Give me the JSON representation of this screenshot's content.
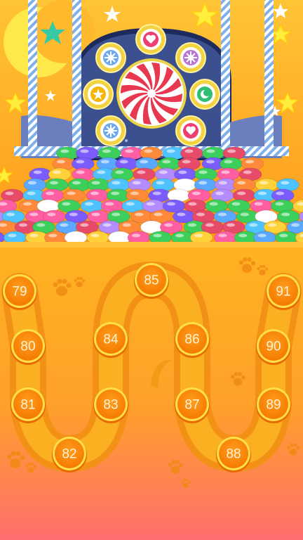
{
  "theme": {
    "sky_top": "#ffc436",
    "sky_bottom": "#ff9a1a",
    "board_top": "#ffb321",
    "board_bottom": "#ff6b6b",
    "path_color": "#f59a17",
    "node_color": "#ff8a00",
    "node_ring": "#ffe15a",
    "machine_blue": "#3c4f8f"
  },
  "machine": {
    "center_icon": "peppermint-candy-icon",
    "slot_icons": [
      "heart-icon",
      "flower-icon",
      "flower-icon",
      "star-icon",
      "moon-icon",
      "flower-icon",
      "heart-icon"
    ]
  },
  "levels": [
    {
      "number": "79"
    },
    {
      "number": "80"
    },
    {
      "number": "81"
    },
    {
      "number": "82"
    },
    {
      "number": "83"
    },
    {
      "number": "84"
    },
    {
      "number": "85"
    },
    {
      "number": "86"
    },
    {
      "number": "87"
    },
    {
      "number": "88"
    },
    {
      "number": "89"
    },
    {
      "number": "90"
    },
    {
      "number": "91"
    }
  ]
}
